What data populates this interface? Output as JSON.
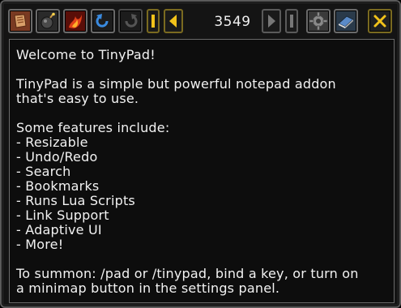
{
  "toolbar": {
    "page_number": "3549",
    "buttons": [
      {
        "name": "new-page-icon",
        "interactable": true
      },
      {
        "name": "run-bomb-icon",
        "interactable": true
      },
      {
        "name": "fire-icon",
        "interactable": true
      },
      {
        "name": "undo-icon",
        "interactable": true
      },
      {
        "name": "redo-icon",
        "interactable": true
      },
      {
        "name": "first-page-icon",
        "interactable": true
      },
      {
        "name": "prev-page-icon",
        "interactable": true
      },
      {
        "name": "next-page-icon",
        "interactable": true
      },
      {
        "name": "last-page-icon",
        "interactable": true
      },
      {
        "name": "gear-icon",
        "interactable": true
      },
      {
        "name": "book-icon",
        "interactable": true
      },
      {
        "name": "close-icon",
        "interactable": true
      }
    ]
  },
  "note": {
    "text": "Welcome to TinyPad!\n\nTinyPad is a simple but powerful notepad addon\nthat's easy to use.\n\nSome features include:\n- Resizable\n- Undo/Redo\n- Search\n- Bookmarks\n- Runs Lua Scripts\n- Link Support\n- Adaptive UI\n- More!\n\nTo summon: /pad or /tinypad, bind a key, or turn on\na minimap button in the settings panel."
  },
  "colors": {
    "gold": "#f2c21a",
    "blue": "#3a8be0",
    "frame": "#6a6a6a",
    "background": "#0d0d0d",
    "text": "#f2f2f2"
  }
}
